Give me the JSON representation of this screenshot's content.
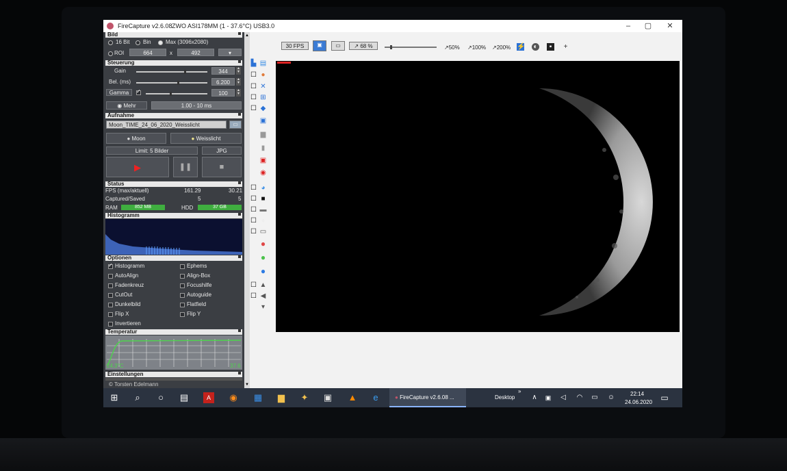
{
  "window": {
    "title": "FireCapture v2.6.08",
    "camera": "ZWO ASI178MM (1 - 37.6°C) USB3.0",
    "controls": {
      "minimize": "–",
      "maximize": "▢",
      "close": "✕"
    }
  },
  "bild": {
    "header": "Bild",
    "opt_16bit": "16 Bit",
    "opt_bin": "Bin",
    "opt_max": "Max (3096x2080)",
    "roi_label": "ROI",
    "roi_w": "664",
    "roi_x": "x",
    "roi_h": "492"
  },
  "steuerung": {
    "header": "Steuerung",
    "gain_label": "Gain",
    "gain_value": "344",
    "bel_label": "Bel. (ms)",
    "bel_value": "6.200",
    "gamma_label": "Gamma",
    "gamma_value": "100",
    "mehr_label": "Mehr",
    "range_value": "1.00 - 10 ms"
  },
  "aufnahme": {
    "header": "Aufnahme",
    "filename": "Moon_TIME_24_06_2020_Weisslicht",
    "btn_moon": "Moon",
    "btn_weisslicht": "Weisslicht",
    "limit": "Limit: 5 Bilder",
    "format": "JPG"
  },
  "status": {
    "header": "Status",
    "fps_label": "FPS (max/aktuell)",
    "fps_max": "161.29",
    "fps_now": "30.21",
    "cs_label": "Captured/Saved",
    "captured": "5",
    "saved": "5",
    "ram_label": "RAM",
    "ram_value": "852 MB",
    "hdd_label": "HDD",
    "hdd_value": "37 GB"
  },
  "histogramm": {
    "header": "Histogramm"
  },
  "optionen": {
    "header": "Optionen",
    "items": [
      {
        "label": "Histogramm",
        "checked": true
      },
      {
        "label": "Ephems",
        "checked": false
      },
      {
        "label": "AutoAlign",
        "checked": false
      },
      {
        "label": "Align-Box",
        "checked": false
      },
      {
        "label": "Fadenkreuz",
        "checked": false
      },
      {
        "label": "Focushilfe",
        "checked": false
      },
      {
        "label": "CutOut",
        "checked": false
      },
      {
        "label": "Autoguide",
        "checked": false
      },
      {
        "label": "Dunkelbild",
        "checked": false
      },
      {
        "label": "Flatfield",
        "checked": false
      },
      {
        "label": "Flip X",
        "checked": false
      },
      {
        "label": "Flip Y",
        "checked": false
      },
      {
        "label": "Invertieren",
        "checked": false
      }
    ]
  },
  "temperatur": {
    "header": "Temperatur",
    "left_value": "24.3°C",
    "right_value": "37.6"
  },
  "einstellungen": {
    "header": "Einstellungen"
  },
  "credit": "© Torsten Edelmann",
  "toolbar": {
    "fps": "30 FPS",
    "zoom": "68 %",
    "z50": "50%",
    "z100": "100%",
    "z200": "200%"
  },
  "taskbar": {
    "app_label": "FireCapture v2.6.08 ...",
    "desktop": "Desktop",
    "time": "22:14",
    "date": "24.06.2020"
  }
}
